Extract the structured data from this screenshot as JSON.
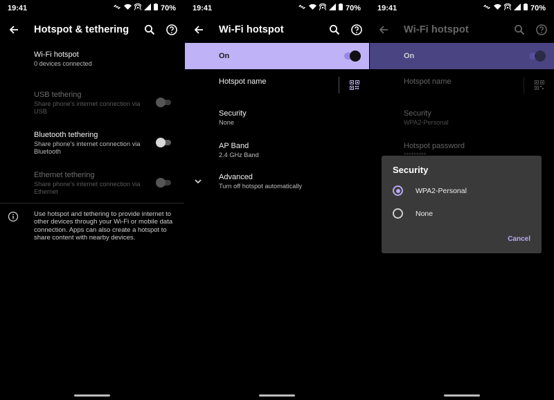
{
  "status": {
    "time": "19:41",
    "battery": "70%"
  },
  "panel1": {
    "title": "Hotspot & tethering",
    "items": [
      {
        "title": "Wi-Fi hotspot",
        "subtitle": "0 devices connected"
      },
      {
        "title": "USB tethering",
        "subtitle": "Share phone's internet connection via USB"
      },
      {
        "title": "Bluetooth tethering",
        "subtitle": "Share phone's internet connection via Bluetooth"
      },
      {
        "title": "Ethernet tethering",
        "subtitle": "Share phone's internet connection via Ethernet"
      }
    ],
    "info": "Use hotspot and tethering to provide internet to other devices through your Wi-Fi or mobile data connection. Apps can also create a hotspot to share content with nearby devices."
  },
  "panel2": {
    "title": "Wi-Fi hotspot",
    "on_label": "On",
    "hotspot_name": "Hotspot name",
    "security": {
      "title": "Security",
      "value": "None"
    },
    "ap_band": {
      "title": "AP Band",
      "value": "2.4 GHz Band"
    },
    "advanced": {
      "title": "Advanced",
      "value": "Turn off hotspot automatically"
    }
  },
  "panel3": {
    "title": "Wi-Fi hotspot",
    "on_label": "On",
    "hotspot_name": "Hotspot name",
    "security": {
      "title": "Security",
      "value": "WPA2-Personal"
    },
    "password": {
      "title": "Hotspot password",
      "value": "*********"
    },
    "dialog": {
      "title": "Security",
      "options": [
        "WPA2-Personal",
        "None"
      ],
      "selected": "WPA2-Personal",
      "cancel": "Cancel"
    }
  },
  "colors": {
    "accent": "#bfb2f7",
    "background": "#000000",
    "dialog": "#3a3a3a"
  }
}
